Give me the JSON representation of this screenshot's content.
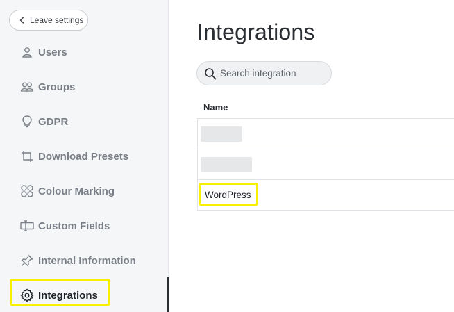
{
  "sidebar": {
    "leave_label": "Leave settings",
    "items": [
      {
        "label": "Users",
        "icon": "user-icon"
      },
      {
        "label": "Groups",
        "icon": "users-icon"
      },
      {
        "label": "GDPR",
        "icon": "lightbulb-icon"
      },
      {
        "label": "Download Presets",
        "icon": "crop-icon"
      },
      {
        "label": "Colour Marking",
        "icon": "circles-icon"
      },
      {
        "label": "Custom Fields",
        "icon": "text-field-icon"
      },
      {
        "label": "Internal Information",
        "icon": "pin-icon"
      },
      {
        "label": "Integrations",
        "icon": "gear-icon",
        "active": true
      }
    ]
  },
  "main": {
    "title": "Integrations",
    "search": {
      "placeholder": "Search integration",
      "value": ""
    },
    "table": {
      "column_header": "Name",
      "rows": [
        {
          "label": "",
          "redacted": true
        },
        {
          "label": "",
          "redacted": true
        },
        {
          "label": "WordPress",
          "redacted": false
        }
      ]
    }
  },
  "colors": {
    "highlight": "#f7f100",
    "sidebar_bg": "#f5f6f7",
    "text_muted": "#7a7f87",
    "text_active": "#1f2329"
  }
}
